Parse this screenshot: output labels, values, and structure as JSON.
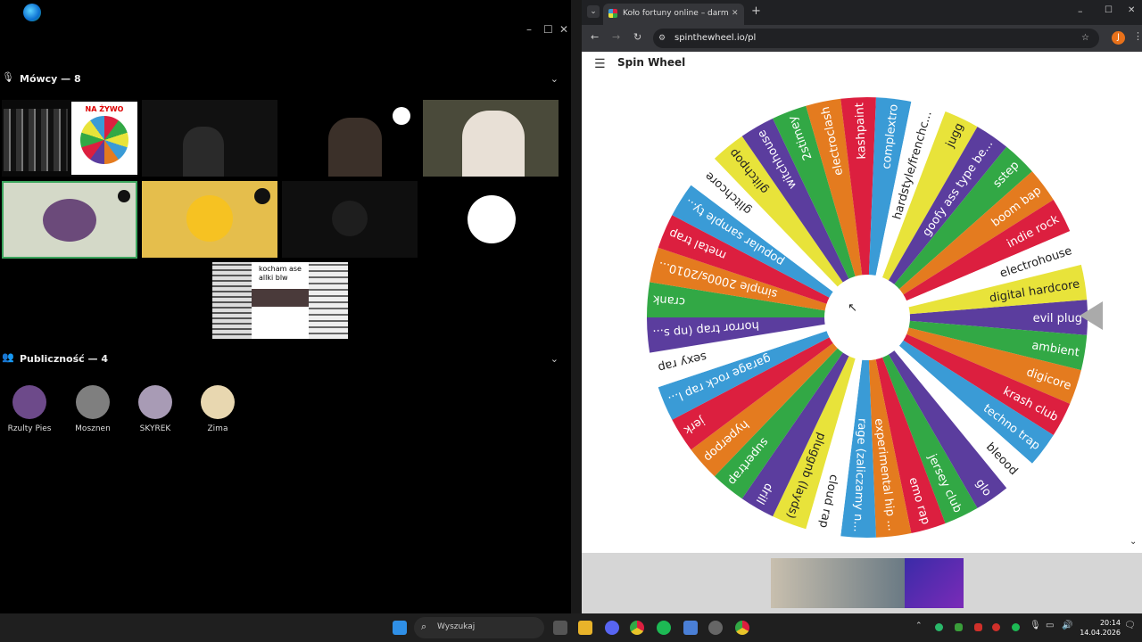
{
  "voice": {
    "speakers_title": "Mówcy — 8",
    "audience_title": "Publiczność — 4",
    "overlay_text": "kocham ase\nallki blw",
    "stream_badge": "NA ŻYWO",
    "audience": [
      {
        "name": "Rzulty Pies",
        "color": "#6d4a8a"
      },
      {
        "name": "Mosznen",
        "color": "#7f7f7f"
      },
      {
        "name": "SKYREK",
        "color": "#a89bb5"
      },
      {
        "name": "Zima",
        "color": "#e8d7b0"
      }
    ]
  },
  "browser": {
    "tab_title": "Koło fortuny online – darm",
    "url": "spinthewheel.io/pl",
    "profile_initial": "J",
    "site_logo": "Spin Wheel"
  },
  "wheel": {
    "entries": [
      "evil plug",
      "ambient",
      "digicore",
      "krash club",
      "techno trap",
      "bleood",
      "glo",
      "jersey club",
      "emo rap",
      "experimental hip ...",
      "rage (zaliczamy n...",
      "cloud rap",
      "pluggnb (layds)",
      "drill",
      "supertrap",
      "hyperpop",
      "jerk",
      "garage rock rap l...",
      "sexy rap",
      "horror trap (np s...",
      "crank",
      "simple 2000s/2010...",
      "metal trap",
      "popular sample ty...",
      "glitchcore",
      "glitchpop",
      "witchhouse",
      "2stimey",
      "electroclash",
      "kashpaint",
      "complextro",
      "hardstyle/frenchc...",
      "jugg",
      "goofy ass type be...",
      "sstep",
      "boom bap",
      "indie rock",
      "electrohouse",
      "digital hardcore"
    ],
    "colors": [
      "#5b3d9e",
      "#32a845",
      "#e47b1f",
      "#dc1f3f",
      "#3a9bd6",
      "#ffffff",
      "#5b3d9e",
      "#32a845",
      "#dc1f3f",
      "#e47b1f",
      "#3a9bd6",
      "#ffffff",
      "#e8e33a",
      "#5b3d9e",
      "#32a845",
      "#e47b1f",
      "#dc1f3f",
      "#3a9bd6",
      "#ffffff",
      "#5b3d9e",
      "#32a845",
      "#e47b1f",
      "#dc1f3f",
      "#3a9bd6",
      "#ffffff",
      "#e8e33a",
      "#5b3d9e",
      "#32a845",
      "#e47b1f",
      "#dc1f3f",
      "#3a9bd6",
      "#ffffff",
      "#e8e33a",
      "#5b3d9e",
      "#32a845",
      "#e47b1f",
      "#dc1f3f",
      "#ffffff",
      "#e8e33a"
    ]
  },
  "taskbar": {
    "search_placeholder": "Wyszukaj",
    "time": "20:14",
    "date": "14.04.2026"
  }
}
